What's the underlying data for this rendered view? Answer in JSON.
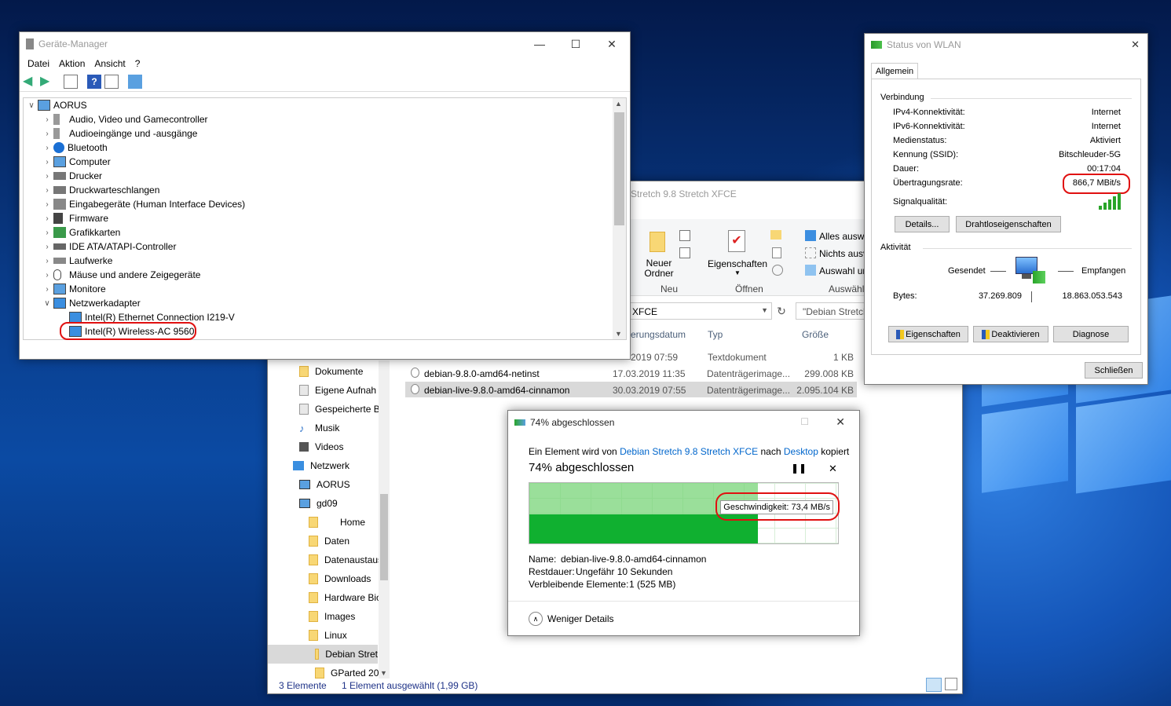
{
  "device_manager": {
    "title": "Geräte-Manager",
    "menu": [
      "Datei",
      "Aktion",
      "Ansicht",
      "?"
    ],
    "root": "AORUS",
    "categories": [
      "Audio, Video und Gamecontroller",
      "Audioeingänge und -ausgänge",
      "Bluetooth",
      "Computer",
      "Drucker",
      "Druckwarteschlangen",
      "Eingabegeräte (Human Interface Devices)",
      "Firmware",
      "Grafikkarten",
      "IDE ATA/ATAPI-Controller",
      "Laufwerke",
      "Mäuse und andere Zeigegeräte",
      "Monitore",
      "Netzwerkadapter"
    ],
    "network_children": [
      "Intel(R) Ethernet Connection I219-V",
      "Intel(R) Wireless-AC 9560"
    ]
  },
  "explorer": {
    "title_fragment": "Stretch 9.8 Stretch XFCE",
    "ribbon": {
      "new_folder": "Neuer Ordner",
      "group_new": "Neu",
      "properties": "Eigenschaften",
      "group_open": "Öffnen",
      "select_all": "Alles ausw",
      "select_none": "Nichts ausv",
      "invert_selection": "Auswahl ur",
      "group_select": "Auswähl"
    },
    "address_fragment": "XFCE",
    "search_placeholder": "\"Debian Stretch",
    "columns": {
      "date": "erungsdatum",
      "type": "Typ",
      "size": "Größe"
    },
    "files": [
      {
        "name": "",
        "date": "2019 07:59",
        "type": "Textdokument",
        "size": "1 KB"
      },
      {
        "name": "debian-9.8.0-amd64-netinst",
        "date": "17.03.2019 11:35",
        "type": "Datenträgerimage...",
        "size": "299.008 KB"
      },
      {
        "name": "debian-live-9.8.0-amd64-cinnamon",
        "date": "30.03.2019 07:55",
        "type": "Datenträgerimage...",
        "size": "2.095.104 KB"
      }
    ],
    "nav": [
      "Dokumente",
      "Eigene Aufnah",
      "Gespeicherte B",
      "Musik",
      "Videos",
      "Netzwerk",
      "AORUS",
      "gd09",
      "Home",
      "Daten",
      "Datenaustaus",
      "Downloads",
      "Hardware Bio",
      "Images",
      "Linux",
      "Debian Stret",
      "GParted 201"
    ],
    "status_count": "3 Elemente",
    "status_selected": "1 Element ausgewählt (1,99 GB)"
  },
  "wlan": {
    "title": "Status von WLAN",
    "tab": "Allgemein",
    "section_connection": "Verbindung",
    "rows": [
      {
        "label": "IPv4-Konnektivität:",
        "value": "Internet"
      },
      {
        "label": "IPv6-Konnektivität:",
        "value": "Internet"
      },
      {
        "label": "Medienstatus:",
        "value": "Aktiviert"
      },
      {
        "label": "Kennung (SSID):",
        "value": "Bitschleuder-5G"
      },
      {
        "label": "Dauer:",
        "value": "00:17:04"
      },
      {
        "label": "Übertragungsrate:",
        "value": "866,7 MBit/s"
      }
    ],
    "signal_label": "Signalqualität:",
    "details_btn": "Details...",
    "wireless_props_btn": "Drahtloseigenschaften",
    "section_activity": "Aktivität",
    "sent_label": "Gesendet",
    "received_label": "Empfangen",
    "bytes_label": "Bytes:",
    "bytes_sent": "37.269.809",
    "bytes_received": "18.863.053.543",
    "properties_btn": "Eigenschaften",
    "disable_btn": "Deaktivieren",
    "diagnose_btn": "Diagnose",
    "close_btn": "Schließen"
  },
  "copy": {
    "title": "74% abgeschlossen",
    "line_prefix": "Ein Element wird von",
    "source": "Debian Stretch 9.8 Stretch XFCE",
    "line_mid": "nach",
    "dest": "Desktop",
    "line_suffix": "kopiert",
    "heading": "74% abgeschlossen",
    "progress_percent": 74,
    "speed": "Geschwindigkeit: 73,4 MB/s",
    "name_label": "Name:",
    "name_value": "debian-live-9.8.0-amd64-cinnamon",
    "remaining_label": "Restdauer:",
    "remaining_value": "Ungefähr 10 Sekunden",
    "items_label": "Verbleibende Elemente:",
    "items_value": "1 (525 MB)",
    "less_details": "Weniger Details"
  }
}
